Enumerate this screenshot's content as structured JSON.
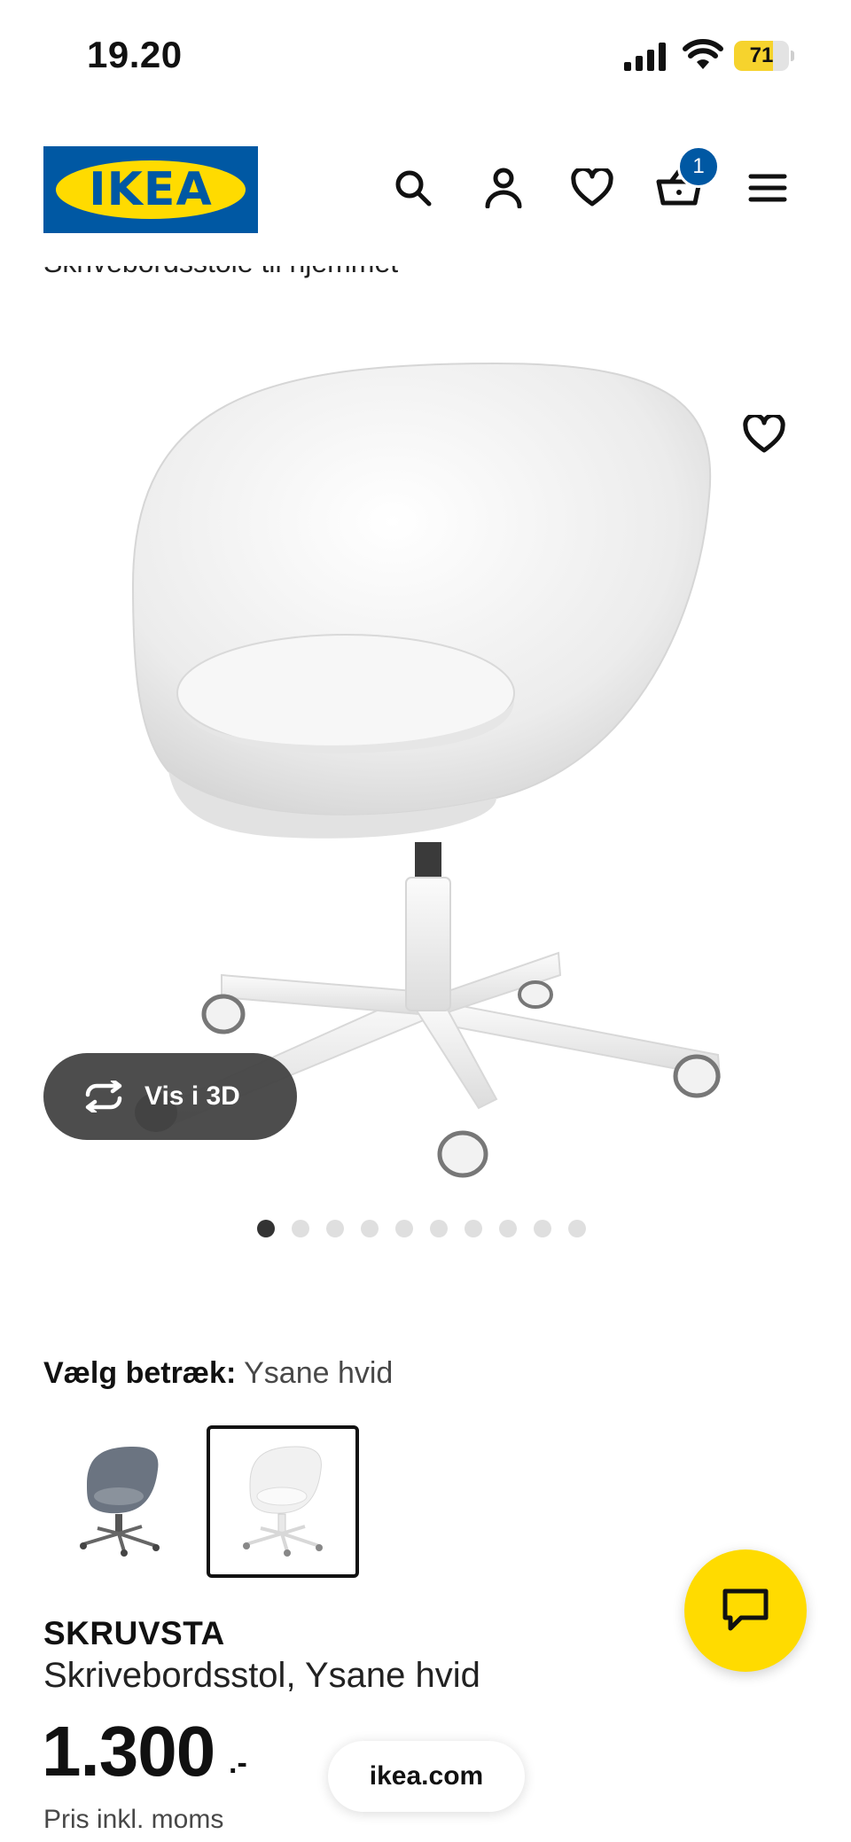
{
  "status_bar": {
    "time": "19.20",
    "battery_level": "71",
    "battery_fraction": 0.71
  },
  "header": {
    "logo_text": "IKEA",
    "cart_count": "1",
    "icons": [
      "search-icon",
      "profile-icon",
      "heart-icon",
      "cart-icon",
      "menu-icon"
    ]
  },
  "breadcrumb": {
    "text": "Skrivebordsstole til hjemmet"
  },
  "gallery": {
    "view_3d_label": "Vis i 3D",
    "dot_count": 10,
    "active_dot": 1
  },
  "options": {
    "label": "Vælg betræk:",
    "selected_value": "Ysane hvid",
    "swatches": [
      {
        "color": "#6b7481",
        "name": "grey-chair-swatch"
      },
      {
        "color": "#f1f1f1",
        "name": "white-chair-swatch"
      }
    ],
    "selected_index": 1
  },
  "product": {
    "name": "SKRUVSTA",
    "description": "Skrivebordsstol, Ysane hvid",
    "price": "1.300",
    "price_suffix": ".-",
    "price_note": "Pris inkl. moms"
  },
  "browser": {
    "url": "ikea.com"
  },
  "colors": {
    "ikea_blue": "#0058a3",
    "ikea_yellow": "#ffdb00",
    "dark_pill": "#424242"
  }
}
